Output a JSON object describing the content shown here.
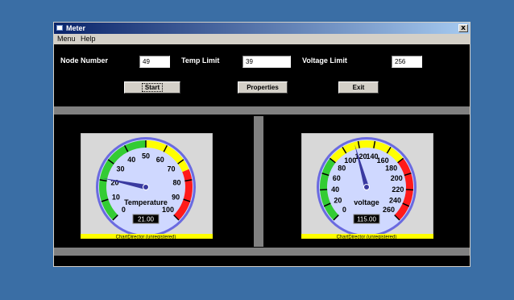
{
  "window": {
    "title": "Meter",
    "close_label": "x"
  },
  "menu": {
    "items": [
      "Menu",
      "Help"
    ]
  },
  "controls": {
    "node_number": {
      "label": "Node Number",
      "value": "49"
    },
    "temp_limit": {
      "label": "Temp Limit",
      "value": "39"
    },
    "voltage_limit": {
      "label": "Voltage Limit",
      "value": "256"
    }
  },
  "buttons": {
    "start": "Start",
    "properties": "Properties",
    "exit": "Exit"
  },
  "gauges": {
    "temperature": {
      "label": "Temperature",
      "value": 21,
      "readout": "21.00",
      "min": 0,
      "max": 100,
      "ticks": [
        "0",
        "10",
        "20",
        "30",
        "40",
        "50",
        "60",
        "70",
        "80",
        "90",
        "100"
      ],
      "footer": "ChartDirector (unregistered)"
    },
    "voltage": {
      "label": "voltage",
      "value": 115,
      "readout": "115.00",
      "min": 0,
      "max": 260,
      "ticks": [
        "0",
        "20",
        "40",
        "60",
        "80",
        "100",
        "120",
        "140",
        "160",
        "180",
        "200",
        "220",
        "240",
        "260"
      ],
      "footer": "ChartDirector (unregistered)"
    }
  },
  "colors": {
    "desktop": "#3a6ea5",
    "zone_green": "#33cc33",
    "zone_yellow": "#ffff00",
    "zone_red": "#ff1a1a",
    "dial_face": "#cfd8ff",
    "footer_bg": "#ffff00"
  }
}
